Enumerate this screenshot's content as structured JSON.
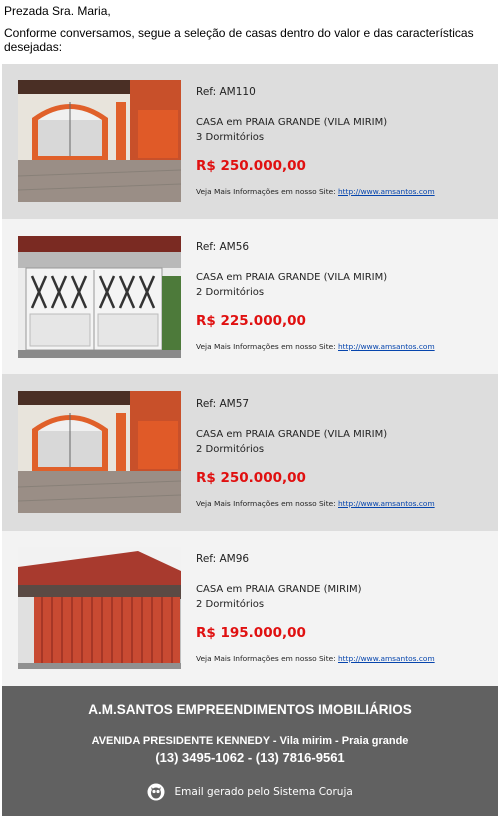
{
  "email": {
    "greeting": "Prezada Sra. Maria,",
    "intro": "Conforme conversamos, segue a seleção de casas dentro do valor e das características desejadas:"
  },
  "listings": [
    {
      "ref": "Ref: AM110",
      "title": "CASA em PRAIA GRANDE (VILA MIRIM)",
      "rooms": "3 Dormitórios",
      "price": "R$ 250.000,00",
      "more_text": "Veja Mais Informações em nosso Site:",
      "more_link": "http://www.amsantos.com"
    },
    {
      "ref": "Ref: AM56",
      "title": "CASA em PRAIA GRANDE (VILA MIRIM)",
      "rooms": "2 Dormitórios",
      "price": "R$ 225.000,00",
      "more_text": "Veja Mais Informações em nosso Site:",
      "more_link": "http://www.amsantos.com"
    },
    {
      "ref": "Ref: AM57",
      "title": "CASA em PRAIA GRANDE (VILA MIRIM)",
      "rooms": "2 Dormitórios",
      "price": "R$ 250.000,00",
      "more_text": "Veja Mais Informações em nosso Site:",
      "more_link": "http://www.amsantos.com"
    },
    {
      "ref": "Ref: AM96",
      "title": "CASA em PRAIA GRANDE (MIRIM)",
      "rooms": "2 Dormitórios",
      "price": "R$ 195.000,00",
      "more_text": "Veja Mais Informações em nosso Site:",
      "more_link": "http://www.amsantos.com"
    }
  ],
  "footer": {
    "company": "A.M.SANTOS EMPREENDIMENTOS IMOBILIÁRIOS",
    "address": "AVENIDA PRESIDENTE KENNEDY - Vila mirim - Praia grande",
    "phones": "(13) 3495-1062 - (13) 7816-9561",
    "generated": "Email gerado pelo Sistema Coruja"
  },
  "colors": {
    "price": "#e01010",
    "link": "#0645ad",
    "footer_bg": "#616161",
    "row_gray": "#dddddd",
    "row_light": "#f3f3f3"
  }
}
